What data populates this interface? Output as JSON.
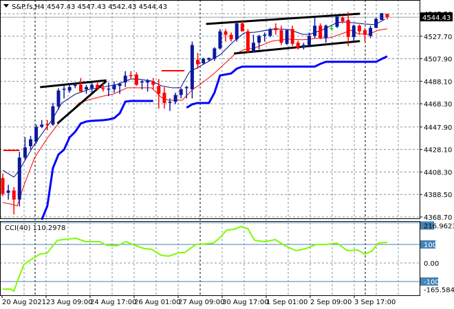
{
  "header": {
    "symbol": "S&P.fs,H4",
    "ohlc": "4547.43 4547.43 4542.43 4544.43"
  },
  "colors": {
    "bull": "#0a1a9e",
    "bear": "#ff0000",
    "doji": "#00e000",
    "ma_fast": "#000080",
    "ma_slow": "#ff0000",
    "envelope": "#0000ff",
    "cci": "#7cfc00",
    "level": "#4682b4",
    "trend": "#000000",
    "grid": "#8090a0"
  },
  "chart_data": {
    "type": "candlestick",
    "price_ylim": [
      4368.7,
      4547.5
    ],
    "price_ticks": [
      "4547.50",
      "4527.70",
      "4507.90",
      "4488.10",
      "4468.30",
      "4447.90",
      "4428.10",
      "4408.30",
      "4388.50",
      "4368.70"
    ],
    "price_tick_values": [
      4547.5,
      4527.7,
      4507.9,
      4488.1,
      4468.3,
      4447.9,
      4428.1,
      4408.3,
      4388.5,
      4368.7
    ],
    "current_price": {
      "label": "4544.43",
      "value": 4544.43
    },
    "candles_ohlc": [
      [
        4403,
        4407,
        4387,
        4389
      ],
      [
        4390,
        4397,
        4384,
        4392
      ],
      [
        4392,
        4395,
        4371,
        4384
      ],
      [
        4384,
        4426,
        4378,
        4421
      ],
      [
        4421,
        4439,
        4419,
        4430
      ],
      [
        4431,
        4440,
        4428,
        4437
      ],
      [
        4435,
        4450,
        4433,
        4448
      ],
      [
        4448,
        4454,
        4447,
        4450
      ],
      [
        4450.5,
        4454,
        4445,
        4449.5
      ],
      [
        4450,
        4469,
        4449,
        4466
      ],
      [
        4466,
        4482,
        4463,
        4480
      ],
      [
        4481,
        4484,
        4473,
        4481.5
      ],
      [
        4480,
        4486,
        4478,
        4483
      ],
      [
        4484,
        4486,
        4482,
        4485
      ],
      [
        4485,
        4491,
        4479,
        4479
      ],
      [
        4481,
        4485,
        4477,
        4483
      ],
      [
        4482,
        4487,
        4478,
        4485
      ],
      [
        4485,
        4488,
        4480,
        4482
      ],
      [
        4482,
        4486,
        4479,
        4481
      ],
      [
        4481,
        4487,
        4475,
        4481.6
      ],
      [
        4481,
        4488,
        4478,
        4485
      ],
      [
        4484,
        4487,
        4477,
        4486
      ],
      [
        4487,
        4497,
        4483,
        4493
      ],
      [
        4493.5,
        4497,
        4490,
        4492.8
      ],
      [
        4494,
        4496,
        4484,
        4485
      ],
      [
        4487,
        4489,
        4481,
        4488
      ],
      [
        4487,
        4490,
        4479,
        4488.5
      ],
      [
        4488,
        4491,
        4481,
        4485
      ],
      [
        4484,
        4490,
        4464,
        4477
      ],
      [
        4478,
        4483,
        4464,
        4469
      ],
      [
        4469.5,
        4473,
        4462,
        4470
      ],
      [
        4470,
        4478,
        4468,
        4476
      ],
      [
        4476,
        4482,
        4473,
        4481
      ],
      [
        4482,
        4484,
        4473,
        4483
      ],
      [
        4481,
        4523,
        4473,
        4520
      ],
      [
        4507,
        4513,
        4499,
        4503
      ],
      [
        4504,
        4509,
        4503,
        4508
      ],
      [
        4507,
        4509,
        4506,
        4508.5
      ],
      [
        4508,
        4518,
        4506,
        4517
      ],
      [
        4517,
        4534,
        4516,
        4532
      ],
      [
        4532,
        4534,
        4523,
        4529
      ],
      [
        4529,
        4531,
        4523,
        4525
      ],
      [
        4525,
        4540,
        4523,
        4539
      ],
      [
        4539,
        4542,
        4532,
        4532
      ],
      [
        4532,
        4534,
        4513,
        4514
      ],
      [
        4514,
        4529,
        4514,
        4522
      ],
      [
        4522,
        4529,
        4516,
        4528
      ],
      [
        4528,
        4531,
        4523,
        4529
      ],
      [
        4528,
        4535,
        4527,
        4534
      ],
      [
        4535,
        4539,
        4529,
        4533
      ],
      [
        4533,
        4537,
        4520,
        4522
      ],
      [
        4521,
        4534,
        4520,
        4533
      ],
      [
        4534,
        4537,
        4519,
        4521
      ],
      [
        4522,
        4524,
        4516,
        4517
      ],
      [
        4518,
        4522,
        4516,
        4520
      ],
      [
        4520,
        4531,
        4519,
        4528
      ],
      [
        4528,
        4544,
        4526,
        4537
      ],
      [
        4537,
        4539,
        4525,
        4526
      ],
      [
        4526,
        4538,
        4522,
        4537
      ],
      [
        4535,
        4537,
        4533,
        4535
      ],
      [
        4536,
        4545,
        4535,
        4545
      ],
      [
        4544,
        4545,
        4539,
        4541
      ],
      [
        4542,
        4549,
        4519,
        4527
      ],
      [
        4527,
        4538,
        4523,
        4537
      ],
      [
        4537,
        4538,
        4529,
        4532
      ],
      [
        4533,
        4535,
        4523,
        4529
      ],
      [
        4528,
        4537,
        4526,
        4535
      ],
      [
        4535,
        4544,
        4535,
        4543
      ],
      [
        4542,
        4548,
        4542,
        4548
      ],
      [
        4547.43,
        4547.43,
        4542.43,
        4544.43
      ]
    ],
    "ma_fast": [
      [
        0,
        4409.8
      ],
      [
        2,
        4403.8
      ],
      [
        2.8,
        4408.6
      ],
      [
        5.7,
        4432.8
      ],
      [
        8.8,
        4453.9
      ],
      [
        10.6,
        4469
      ],
      [
        13.1,
        4476.9
      ],
      [
        15.6,
        4481.1
      ],
      [
        18,
        4482.9
      ],
      [
        20.5,
        4485.3
      ],
      [
        23,
        4490.1
      ],
      [
        24.2,
        4490.1
      ],
      [
        26.7,
        4488.3
      ],
      [
        28.5,
        4484.1
      ],
      [
        30.4,
        4482.3
      ],
      [
        31.9,
        4482.3
      ],
      [
        33.5,
        4496.2
      ],
      [
        35.3,
        4501
      ],
      [
        39,
        4511.3
      ],
      [
        41.5,
        4523.4
      ],
      [
        43.3,
        4530.6
      ],
      [
        45.2,
        4531.2
      ],
      [
        48.9,
        4534.2
      ],
      [
        51.4,
        4533.6
      ],
      [
        53.8,
        4529.4
      ],
      [
        55.1,
        4529.4
      ],
      [
        57.5,
        4533.6
      ],
      [
        60,
        4539.7
      ],
      [
        61.2,
        4540.3
      ],
      [
        62.5,
        4539.7
      ],
      [
        64.9,
        4538.5
      ],
      [
        66.8,
        4537.9
      ],
      [
        68.6,
        4542.7
      ]
    ],
    "ma_slow": [
      [
        0,
        4381.4
      ],
      [
        1.4,
        4380.2
      ],
      [
        2.6,
        4378.4
      ],
      [
        3.8,
        4396.5
      ],
      [
        5.7,
        4420.7
      ],
      [
        8.1,
        4438.8
      ],
      [
        10,
        4450.9
      ],
      [
        11.9,
        4459.9
      ],
      [
        13.7,
        4469
      ],
      [
        15.6,
        4472
      ],
      [
        18,
        4475
      ],
      [
        19.9,
        4476.9
      ],
      [
        22.3,
        4482.3
      ],
      [
        24.2,
        4482.3
      ],
      [
        26.7,
        4482.3
      ],
      [
        28.5,
        4473.8
      ],
      [
        29.8,
        4471.4
      ],
      [
        32.2,
        4471.4
      ],
      [
        34.1,
        4481.1
      ],
      [
        35.3,
        4484.7
      ],
      [
        37.8,
        4494.4
      ],
      [
        40.2,
        4505.2
      ],
      [
        41.5,
        4511.3
      ],
      [
        43.3,
        4516.1
      ],
      [
        45.2,
        4517.3
      ],
      [
        48.3,
        4523.4
      ],
      [
        51.4,
        4525.2
      ],
      [
        53.8,
        4524.6
      ],
      [
        56.3,
        4525.8
      ],
      [
        58.8,
        4526.4
      ],
      [
        61.2,
        4530.6
      ],
      [
        62.5,
        4533
      ],
      [
        63.7,
        4530
      ],
      [
        65.6,
        4529.4
      ],
      [
        67.4,
        4533
      ],
      [
        69,
        4534.2
      ]
    ],
    "envelope_segments": [
      [
        [
          7,
          4366.3
        ],
        [
          8,
          4378.4
        ],
        [
          9,
          4411.6
        ],
        [
          10,
          4423.7
        ],
        [
          11,
          4427.9
        ],
        [
          12,
          4438.8
        ],
        [
          13,
          4443.6
        ],
        [
          14,
          4450.9
        ],
        [
          15,
          4452.7
        ],
        [
          16,
          4453.3
        ],
        [
          18,
          4453.9
        ],
        [
          19,
          4454.5
        ],
        [
          20,
          4455.7
        ],
        [
          21,
          4459.9
        ],
        [
          22,
          4470.2
        ],
        [
          23,
          4470.8
        ],
        [
          27,
          4470.8
        ]
      ],
      [
        [
          33,
          4464.8
        ],
        [
          34,
          4467.8
        ],
        [
          35,
          4469
        ],
        [
          37,
          4469
        ],
        [
          38,
          4478
        ],
        [
          39,
          4493.2
        ],
        [
          41,
          4495
        ],
        [
          42,
          4499.2
        ],
        [
          43,
          4501
        ],
        [
          56,
          4501
        ],
        [
          57,
          4503.4
        ],
        [
          58,
          4505.2
        ],
        [
          67,
          4505.2
        ],
        [
          68,
          4507.7
        ],
        [
          69,
          4510.1
        ]
      ]
    ],
    "trendlines": [
      [
        [
          6.7,
          4482.9
        ],
        [
          18.6,
          4488.9
        ]
      ],
      [
        [
          9.8,
          4450.9
        ],
        [
          18.6,
          4488.3
        ]
      ],
      [
        [
          36.5,
          4538.5
        ],
        [
          64.1,
          4547.5
        ]
      ],
      [
        [
          41.5,
          4512.5
        ],
        [
          64.1,
          4523.4
        ]
      ]
    ],
    "hlines": [
      [
        [
          0.1,
          4427.3
        ],
        [
          3,
          4427.3
        ]
      ],
      [
        [
          28.5,
          4497.4
        ],
        [
          32.6,
          4497.4
        ]
      ]
    ],
    "cci": {
      "title": "CCI(40) 110.2978",
      "ylim": [
        -165.584,
        216.9623
      ],
      "ticks": [
        "216.9623",
        "100",
        "0.00",
        "-100",
        "-165.584"
      ],
      "levels": [
        100,
        -100
      ],
      "points": [
        [
          0,
          -140.7
        ],
        [
          1.4,
          -140.7
        ],
        [
          2,
          -151.9
        ],
        [
          2.6,
          -100
        ],
        [
          3.8,
          -7.4
        ],
        [
          5.1,
          18.5
        ],
        [
          6.7,
          48.1
        ],
        [
          7.9,
          51.9
        ],
        [
          9.8,
          122.2
        ],
        [
          11.9,
          129.6
        ],
        [
          13.1,
          133.3
        ],
        [
          14.9,
          114.8
        ],
        [
          17.4,
          114.8
        ],
        [
          18.6,
          96.3
        ],
        [
          20.5,
          92.6
        ],
        [
          22.1,
          114.8
        ],
        [
          23.6,
          96.3
        ],
        [
          25.4,
          77.8
        ],
        [
          26.7,
          74.1
        ],
        [
          28.5,
          40.7
        ],
        [
          29.8,
          37
        ],
        [
          31.6,
          55.6
        ],
        [
          32.6,
          55.6
        ],
        [
          34.7,
          100
        ],
        [
          36.5,
          103.7
        ],
        [
          37.8,
          107.4
        ],
        [
          39,
          137
        ],
        [
          40.2,
          177.8
        ],
        [
          41.5,
          181.5
        ],
        [
          42.7,
          196.3
        ],
        [
          44,
          185.2
        ],
        [
          45.2,
          122.2
        ],
        [
          47,
          114.8
        ],
        [
          48.9,
          125.9
        ],
        [
          50.7,
          92.6
        ],
        [
          52.6,
          66.7
        ],
        [
          54.4,
          77.8
        ],
        [
          56.3,
          100
        ],
        [
          58.1,
          100
        ],
        [
          60,
          107.4
        ],
        [
          61.8,
          66.7
        ],
        [
          63.7,
          70.4
        ],
        [
          64.9,
          48.1
        ],
        [
          66.2,
          63
        ],
        [
          67.4,
          107.4
        ],
        [
          69,
          111.1
        ]
      ]
    },
    "time_labels": [
      "20 Aug 2021",
      "23 Aug 09:00",
      "24 Aug 17:00",
      "26 Aug 01:00",
      "27 Aug 09:00",
      "30 Aug 17:00",
      "1 Sep 01:00",
      "2 Sep 09:00",
      "3 Sep 17:00"
    ]
  }
}
